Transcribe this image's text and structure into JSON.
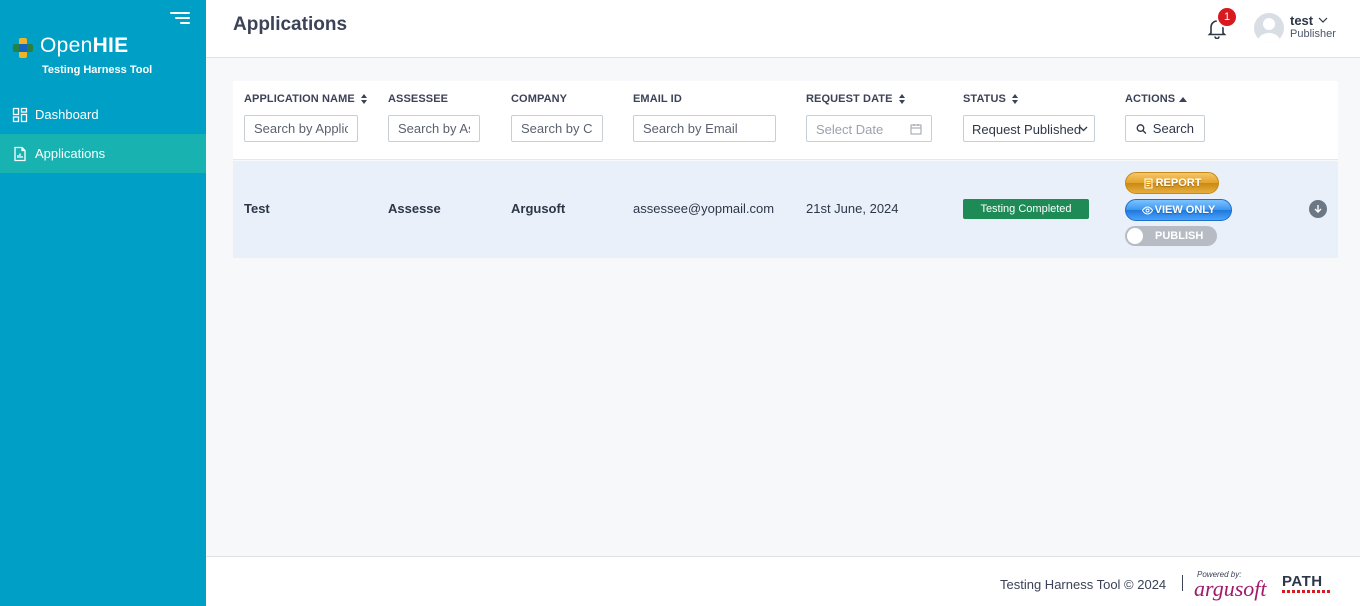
{
  "sidebar": {
    "logo_open": "Open",
    "logo_hie": "HIE",
    "logo_subtitle": "Testing Harness Tool",
    "items": [
      {
        "label": "Dashboard",
        "icon": "dashboard-icon",
        "active": false
      },
      {
        "label": "Applications",
        "icon": "document-chart-icon",
        "active": true
      }
    ]
  },
  "header": {
    "title": "Applications",
    "notification_count": "1",
    "user_name": "test",
    "user_role": "Publisher"
  },
  "table": {
    "columns": {
      "application_name": "APPLICATION NAME",
      "assessee": "ASSESSEE",
      "company": "COMPANY",
      "email_id": "EMAIL ID",
      "request_date": "REQUEST DATE",
      "status": "STATUS",
      "actions": "ACTIONS"
    },
    "filters": {
      "application_name_placeholder": "Search by Application Name",
      "assessee_placeholder": "Search by Assessee",
      "company_placeholder": "Search by Company",
      "email_placeholder": "Search by Email",
      "date_placeholder": "Select Date",
      "status_selected": "Request Published",
      "search_label": "Search"
    },
    "rows": [
      {
        "application_name": "Test",
        "assessee": "Assesse",
        "company": "Argusoft",
        "email": "assessee@yopmail.com",
        "request_date": "21st June, 2024",
        "status": "Testing Completed",
        "actions": {
          "report": "REPORT",
          "view_only": "VIEW ONLY",
          "publish": "PUBLISH"
        }
      }
    ]
  },
  "footer": {
    "text": "Testing Harness Tool © 2024",
    "powered_by": "Powered by:",
    "brand": "argusoft",
    "partner": "PATH"
  },
  "colors": {
    "sidebar_bg": "#00a0c6",
    "sidebar_active": "#18b3b0",
    "status_green": "#1e8a55",
    "badge_red": "#d71920",
    "report_gold": "#e4a227",
    "view_blue": "#3d96f2"
  }
}
